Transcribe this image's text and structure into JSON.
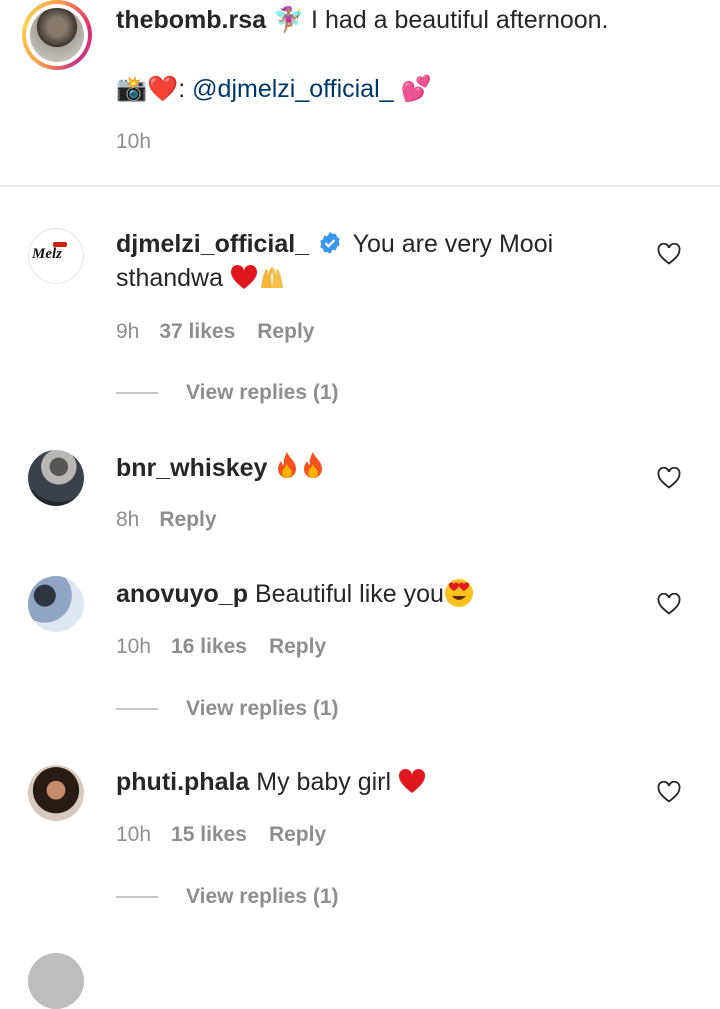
{
  "post": {
    "username": "thebomb.rsa",
    "caption": " 🧚🏽‍♀️ I had a beautiful afternoon.",
    "credit_prefix": "📸❤️: ",
    "credit_link": "@djmelzi_official_",
    "credit_suffix": " 💕",
    "time": "10h"
  },
  "comments": [
    {
      "username": "djmelzi_official_",
      "verified": true,
      "text": "You are very Mooi",
      "text2": "sthandwa",
      "time": "9h",
      "likes": "37 likes",
      "reply": "Reply",
      "view_replies": "View replies (1)",
      "avatar_text": "Melz"
    },
    {
      "username": "bnr_whiskey",
      "text": "",
      "time": "8h",
      "reply": "Reply"
    },
    {
      "username": "anovuyo_p",
      "text": "Beautiful like you",
      "time": "10h",
      "likes": "16 likes",
      "reply": "Reply",
      "view_replies": "View replies (1)"
    },
    {
      "username": "phuti.phala",
      "text": "My baby girl",
      "time": "10h",
      "likes": "15 likes",
      "reply": "Reply",
      "view_replies": "View replies (1)"
    }
  ],
  "icons": {
    "heart_outline": "heart-outline-icon",
    "verified": "verified-badge-icon"
  },
  "colors": {
    "link": "#00376b",
    "meta": "#8e8e8e",
    "verified": "#3897f0",
    "red_heart": "#e0161f"
  }
}
